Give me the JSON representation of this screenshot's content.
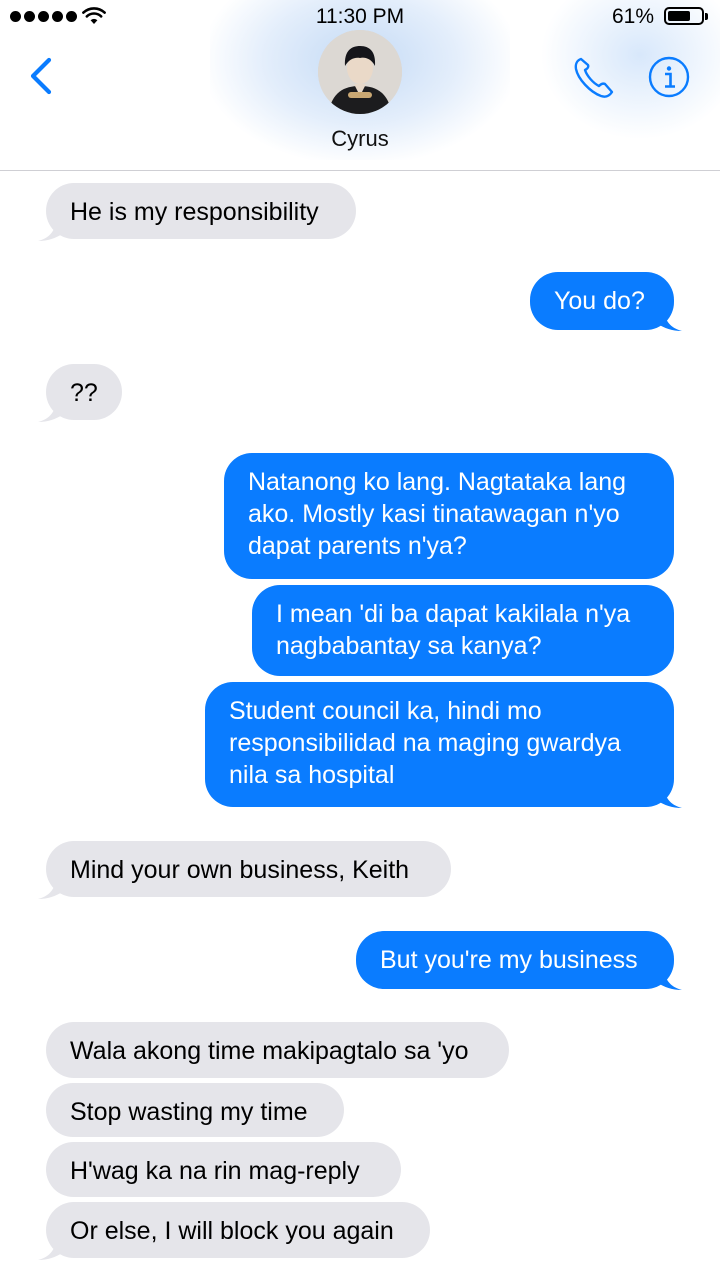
{
  "status_bar": {
    "time": "11:30 PM",
    "battery_percent": "61%",
    "battery_level": 0.61
  },
  "header": {
    "contact_name": "Cyrus",
    "accent": "#0a7cff"
  },
  "colors": {
    "incoming_bubble": "#e5e5ea",
    "outgoing_bubble": "#0a7cff"
  },
  "messages": [
    {
      "dir": "in",
      "text": "He is my responsibility"
    },
    {
      "dir": "out",
      "text": "You do?"
    },
    {
      "dir": "in",
      "text": "??"
    },
    {
      "dir": "out",
      "text": "Natanong ko lang. Nagtataka lang ako. Mostly kasi tinatawagan n'yo dapat parents n'ya?"
    },
    {
      "dir": "out",
      "text": "I mean 'di ba dapat kakilala n'ya nagbabantay sa kanya?"
    },
    {
      "dir": "out",
      "text": "Student council ka, hindi mo responsibilidad na maging gwardya nila sa hospital"
    },
    {
      "dir": "in",
      "text": "Mind your own business, Keith"
    },
    {
      "dir": "out",
      "text": "But you're my business"
    },
    {
      "dir": "in",
      "text": "Wala akong time makipagtalo sa 'yo"
    },
    {
      "dir": "in",
      "text": "Stop wasting my time"
    },
    {
      "dir": "in",
      "text": "H'wag ka na rin mag-reply"
    },
    {
      "dir": "in",
      "text": "Or else, I will block you again"
    }
  ]
}
